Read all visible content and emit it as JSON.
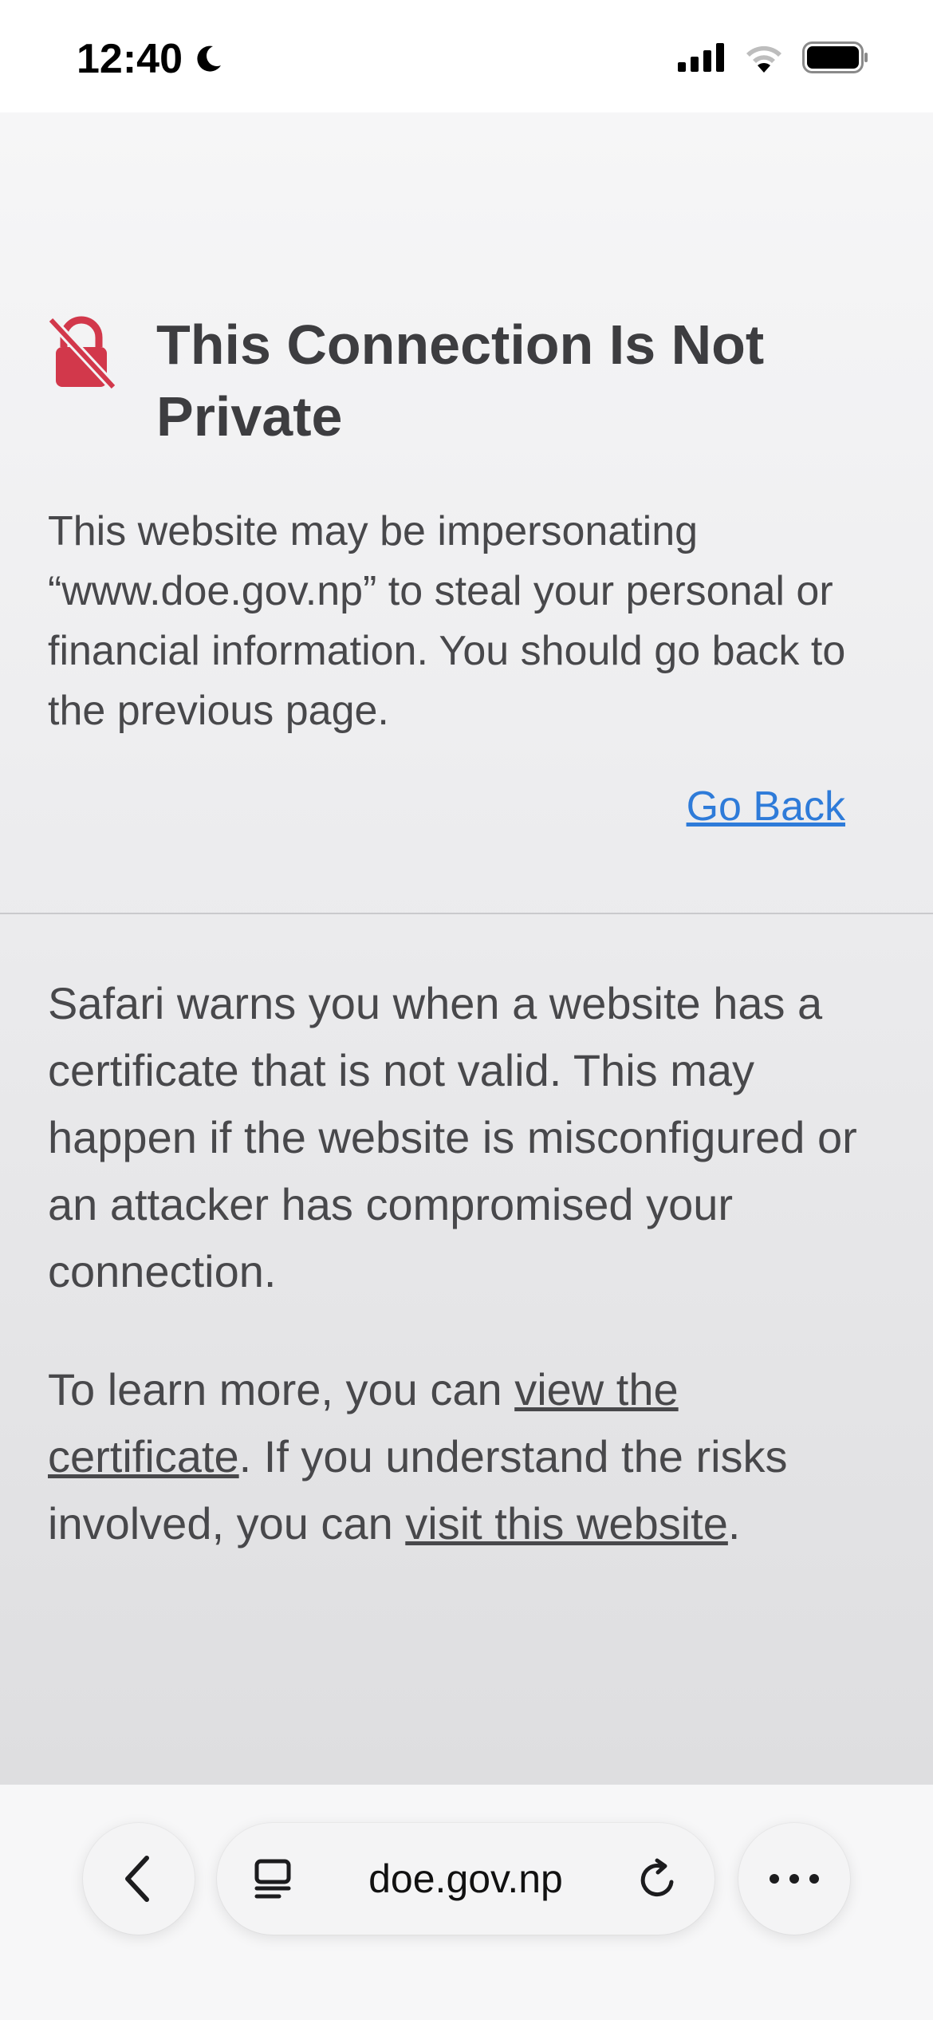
{
  "status_bar": {
    "time": "12:40",
    "icons": [
      "moon-icon",
      "cellular-signal-icon",
      "wifi-icon",
      "battery-icon"
    ]
  },
  "warning": {
    "icon": "lock-slash-icon",
    "icon_color": "#d2384b",
    "title": "This Connection Is Not Private",
    "lead": "This website may be impersonating “www.doe.gov.np” to steal your personal or financial information. You should go back to the previous page.",
    "go_back_label": "Go Back",
    "link_color": "#2e7bd9"
  },
  "details": {
    "paragraph1": "Safari warns you when a website has a certificate that is not valid. This may happen if the website is misconfigured or an attacker has compromised your connection.",
    "paragraph2_before": "To learn more, you can ",
    "view_certificate_label": "view the certificate",
    "paragraph2_middle": ". If you understand the risks involved, you can ",
    "visit_website_label": "visit this website",
    "paragraph2_end": "."
  },
  "toolbar": {
    "back_icon": "chevron-left-icon",
    "tabs_icon": "page-menu-icon",
    "address": "doe.gov.np",
    "reload_icon": "reload-icon",
    "more_icon": "ellipsis-icon"
  }
}
